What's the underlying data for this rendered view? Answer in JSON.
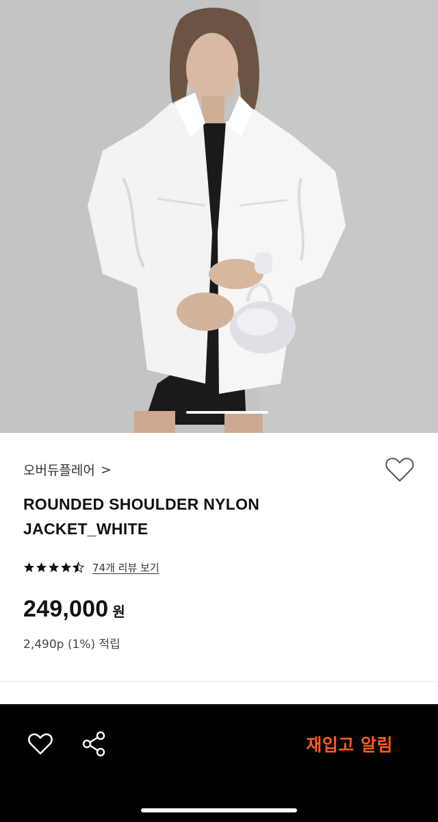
{
  "brand": {
    "name": "오버듀플레어",
    "chevron": ">"
  },
  "product": {
    "title_line1": "ROUNDED SHOULDER NYLON",
    "title_line2": "JACKET_WHITE",
    "rating": 4.5,
    "review_link": "74개 리뷰 보기",
    "price": "249,000",
    "currency": "원",
    "points": "2,490p (1%) 적립"
  },
  "hero": {
    "slide_position": 1
  },
  "icons": {
    "wishlist": "heart-outline-icon",
    "share": "share-icon",
    "chevron": "chevron-right-icon"
  },
  "bottom_bar": {
    "restock_label": "재입고 알림"
  },
  "colors": {
    "accent": "#ff5a1f",
    "bottom_bar_bg": "#000000",
    "text": "#111111"
  }
}
